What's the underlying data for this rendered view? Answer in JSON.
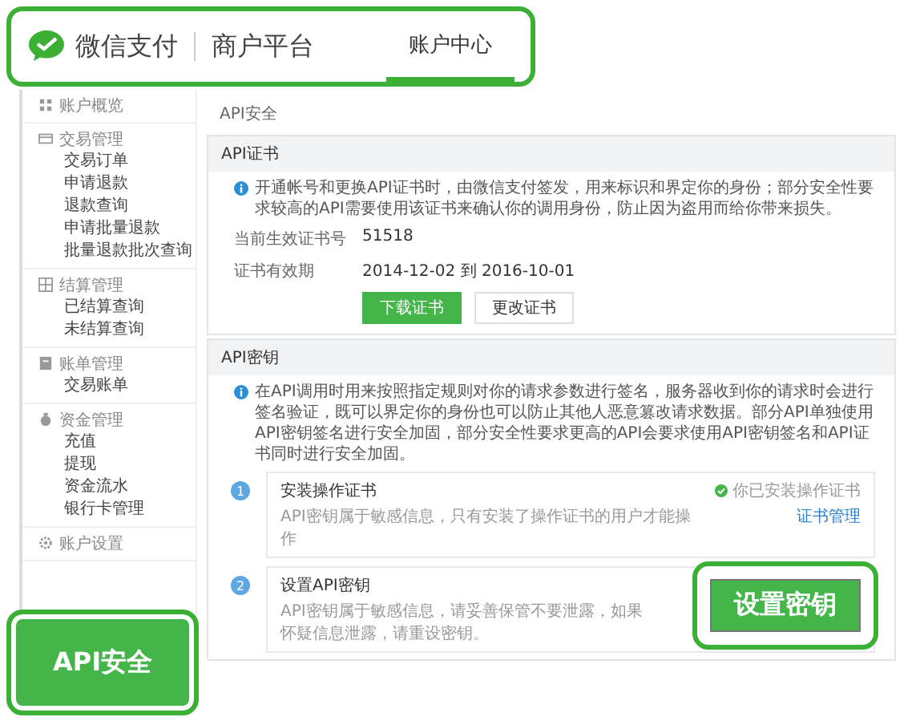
{
  "header": {
    "brand": "微信支付",
    "platform": "商户平台",
    "tabs": [
      {
        "label": "账户中心",
        "selected": true
      }
    ]
  },
  "sidebar": {
    "groups": [
      {
        "title": "账户概览"
      },
      {
        "title": "交易管理",
        "items": [
          "交易订单",
          "申请退款",
          "退款查询",
          "申请批量退款",
          "批量退款批次查询"
        ]
      },
      {
        "title": "结算管理",
        "items": [
          "已结算查询",
          "未结算查询"
        ]
      },
      {
        "title": "账单管理",
        "items": [
          "交易账单"
        ]
      },
      {
        "title": "资金管理",
        "items": [
          "充值",
          "提现",
          "资金流水",
          "银行卡管理"
        ]
      },
      {
        "title": "账户设置"
      }
    ]
  },
  "breadcrumb": "API安全",
  "cert": {
    "title": "API证书",
    "info": "开通帐号和更换API证书时，由微信支付签发，用来标识和界定你的身份；部分安全性要求较高的API需要使用该证书来确认你的调用身份，防止因为盗用而给你带来损失。",
    "fields": [
      {
        "label": "当前生效证书号",
        "value": "51518"
      },
      {
        "label": "证书有效期",
        "value": "2014-12-02  到  2016-10-01"
      }
    ],
    "buttons": [
      {
        "label": "下载证书",
        "primary": true
      },
      {
        "label": "更改证书",
        "primary": false
      }
    ]
  },
  "key": {
    "title": "API密钥",
    "info": "在API调用时用来按照指定规则对你的请求参数进行签名，服务器收到你的请求时会进行签名验证，既可以界定你的身份也可以防止其他人恶意篡改请求数据。部分API单独使用API密钥签名进行安全加固，部分安全性要求更高的API会要求使用API密钥签名和API证书同时进行安全加固。",
    "steps": [
      {
        "number": "1",
        "title": "安装操作证书",
        "desc": "API密钥属于敏感信息，只有安装了操作证书的用户才能操作",
        "status": "你已安装操作证书",
        "link": "证书管理"
      },
      {
        "number": "2",
        "title": "设置API密钥",
        "desc": "API密钥属于敏感信息，请妥善保管不要泄露，如果怀疑信息泄露，请重设密钥。"
      }
    ]
  },
  "callouts": {
    "left": "API安全",
    "right": "设置密钥"
  }
}
